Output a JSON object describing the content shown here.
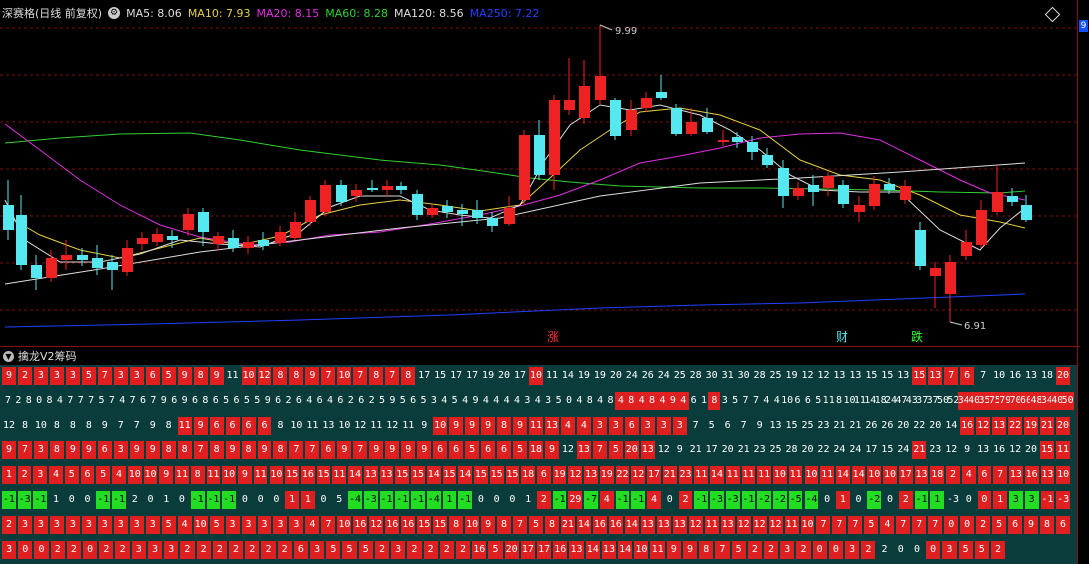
{
  "legend": {
    "stock": "深赛格(日线 前复权)",
    "items": [
      {
        "label": "MA5: 8.06",
        "color": "#dddddd"
      },
      {
        "label": "MA10: 7.93",
        "color": "#e8d040"
      },
      {
        "label": "MA20: 8.15",
        "color": "#e030e0"
      },
      {
        "label": "MA60: 8.28",
        "color": "#30d030"
      },
      {
        "label": "MA120: 8.56",
        "color": "#dddddd"
      },
      {
        "label": "MA250: 7.22",
        "color": "#2040ff"
      }
    ]
  },
  "right_strip": {
    "label": "9"
  },
  "price_labels": {
    "high": "9.99",
    "low": "6.91"
  },
  "markers": {
    "rise": "涨",
    "finance": "财",
    "fall": "跌"
  },
  "indicator": {
    "title": "擒龙V2筹码"
  },
  "colors": {
    "up": "#ee2222",
    "down": "#55e8f0",
    "grid_bg": "#0b3c3c"
  },
  "grid_rows": [
    "9 2 3 3 3 5 7 3 3 6 5 9 8 9 11 10 12 8 8 9 7 10 7 8 7 8 17 15 17 17 19 20 17 10 11 14 19 19 20 24 26 24 25 28 30 31 30 28 25 19 12 12 13 13 15 15 13 15 13 7 6 7 10 16 13 18 20",
    "7 2 8 0 8 4 7 7 7 5 7 4 7 6 7 9 6 9 6 8 6 5 6 5 5 9 6 2 6 4 6 4 6 2 6 2 5 9 5 6 5 3 4 5 4 9 4 4 4 4 3 4 3 5 0 4 8 4 8 4 8 4 8 4 9 4 6 1 8 3 5 7 7 4 4 10 6 6 5 11 8 10 11 14 18 24 47 43 37 37 50 52 34 40 35 75 79 70 60 48 34 40 50",
    "12 8 10 8 8 8 9 7 7 9 8 11 9 6 6 6 6 8 10 11 13 10 12 11 12 11 9 10 9 9 9 8 9 11 13 4 4 3 3 6 3 3 3 7 5 6 7 9 13 15 25 23 21 21 26 26 20 22 20 14 16 12 13 22 19 21 20",
    "9 7 3 8 9 9 6 3 9 9 8 8 7 8 9 8 9 8 7 7 6 9 7 9 9 9 9 6 6 5 6 6 5 18 9 12 13 7 5 20 13 12 9 21 17 20 21 23 25 28 20 22 24 24 17 15 24 21 23 12 9 13 16 12 20 15 11",
    "1 2 3 4 5 6 5 4 10 10 9 11 8 11 10 9 11 10 15 16 15 11 14 13 13 15 15 14 15 14 15 15 15 18 6 19 12 13 19 22 12 17 21 23 11 14 11 11 11 10 11 10 11 14 14 10 10 17 13 18 2 4 6 7 13 16 13 10",
    "-1 -3 -1 1 0 0 -1 -1 2 0 1 0 -1 -1 -1 0 0 0 1 1 0 5 -4 -3 -1 -1 -1 -4 1 -1 0 0 0 1 2 -1 29 -7 4 -1 -1 4 0 2 -1 -3 -3 -1 -2 -2 -5 -4 0 1 0 -2 0 2 -1 1 -3 0 0 1 3 3 -1 -3",
    "2 3 3 3 3 3 3 3 3 3 5 4 10 5 3 3 3 3 3 4 7 10 16 12 16 16 15 15 8 10 9 8 7 5 8 21 14 16 16 14 13 13 13 12 11 13 12 12 12 11 10 7 7 7 5 4 7 7 7 0 0 2 5 6 9 8 6",
    "3 0 0 2 2 0 2 2 3 3 3 2 2 2 2 2 2 2 6 3 5 5 5 2 3 2 2 2 2 16 5 20 17 17 16 13 14 13 14 10 11 9 9 8 7 5 2 2 3 2 0 0 3 2 2 0 0 0 3 5 5 2"
  ]
}
